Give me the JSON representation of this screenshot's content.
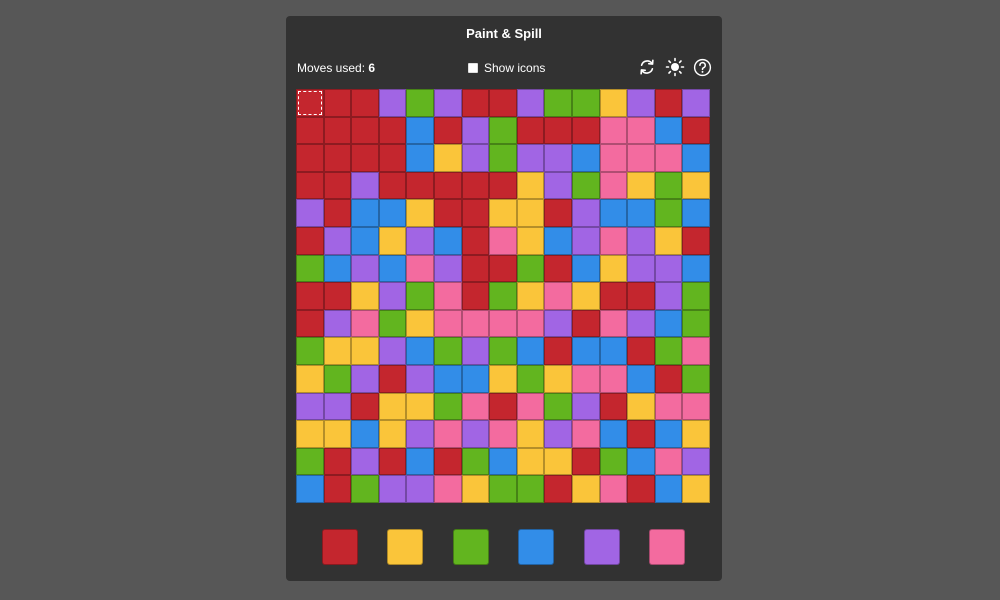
{
  "title": "Paint & Spill",
  "moves": {
    "label": "Moves used:",
    "value": "6"
  },
  "show_icons": {
    "label": "Show icons",
    "checked": false
  },
  "toolbar_icons": [
    "restart-icon",
    "theme-icon",
    "help-icon"
  ],
  "colors": {
    "R": "#c4262e",
    "Y": "#fac53a",
    "G": "#62b51f",
    "B": "#328de8",
    "P": "#a165e4",
    "K": "#f36b9f"
  },
  "selected_cell": {
    "row": 0,
    "col": 0
  },
  "grid": [
    "RRRPGPRRPGGYPRP",
    "RRRRBRPGRRRKKBR",
    "RRRRBYPGPPBKKKB",
    "RRPRRRRRYPGKYGY",
    "PRBBYRRYYRPBBGB",
    "RPBYPBRKYBPKPYR",
    "GBPBKPRRGRBYPPB",
    "RRYPGKRGYKYRRPG",
    "RPKGYKKKKPRKPBG",
    "GYYPBGPGBRBBRGK",
    "YGPRPBBYGYKKBRG",
    "PPRYYGKRKGPRYKK",
    "YYBYPKPKYPKBRBY",
    "GRPRBRGBYYRGBKP",
    "BRGPPKYGGRYKRBY"
  ],
  "palette": [
    "R",
    "Y",
    "G",
    "B",
    "P",
    "K"
  ]
}
